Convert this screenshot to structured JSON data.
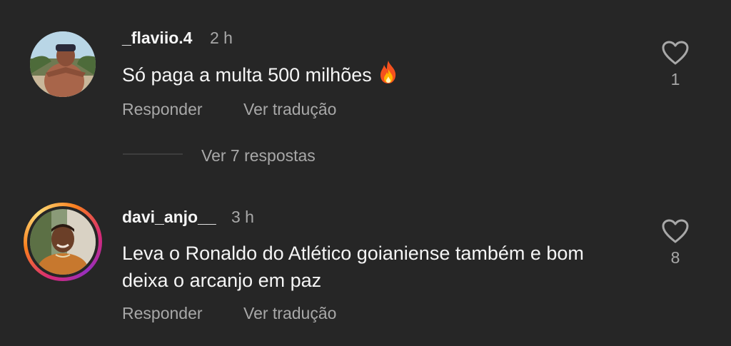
{
  "comments": [
    {
      "username": "_flaviio.4",
      "time": "2 h",
      "text": "Só paga a multa 500 milhões",
      "emoji": "🔥",
      "reply_label": "Responder",
      "translate_label": "Ver tradução",
      "like_count": "1",
      "avatar_icon": "profile-photo",
      "has_story_ring": false
    },
    {
      "username": "davi_anjo__",
      "time": "3 h",
      "text": "Leva o Ronaldo do Atlético goianiense também e bom deixa o arcanjo em paz",
      "reply_label": "Responder",
      "translate_label": "Ver tradução",
      "like_count": "8",
      "avatar_icon": "profile-photo",
      "has_story_ring": true
    }
  ],
  "thread": {
    "view_replies_label": "Ver 7 respostas"
  },
  "colors": {
    "background": "#262626",
    "primary_text": "#f5f5f5",
    "secondary_text": "#a8a8a8"
  }
}
